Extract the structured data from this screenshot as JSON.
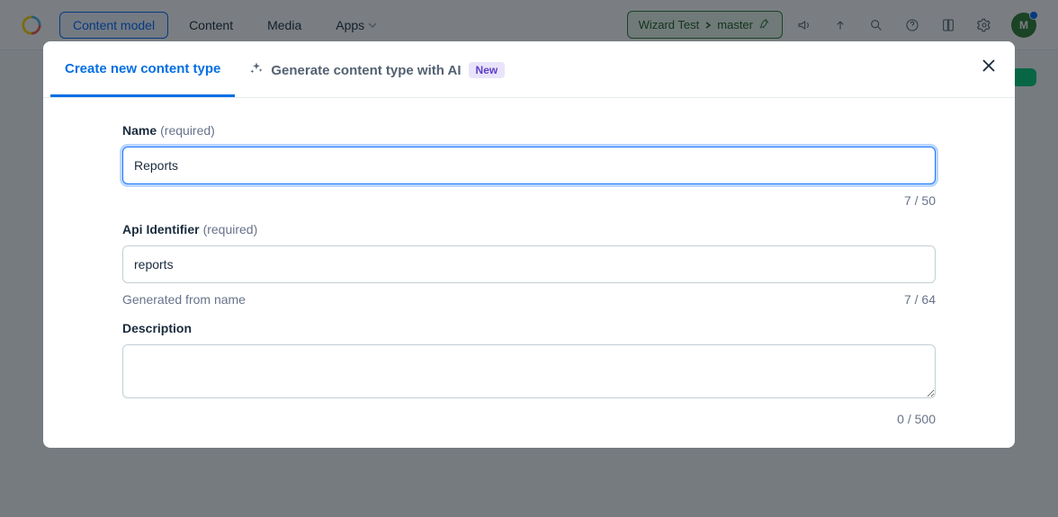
{
  "nav": {
    "items": {
      "content_model": "Content model",
      "content": "Content",
      "media": "Media",
      "apps": "Apps"
    },
    "env": {
      "space": "Wizard Test",
      "branch": "master"
    },
    "avatar_initial": "M"
  },
  "modal": {
    "tabs": {
      "create": "Create new content type",
      "generate": "Generate content type with AI",
      "new_badge": "New"
    },
    "fields": {
      "name": {
        "label": "Name",
        "required": "(required)",
        "value": "Reports",
        "counter": "7 / 50"
      },
      "api": {
        "label": "Api Identifier",
        "required": "(required)",
        "value": "reports",
        "hint": "Generated from name",
        "counter": "7 / 64"
      },
      "desc": {
        "label": "Description",
        "value": "",
        "counter": "0 / 500"
      }
    }
  }
}
